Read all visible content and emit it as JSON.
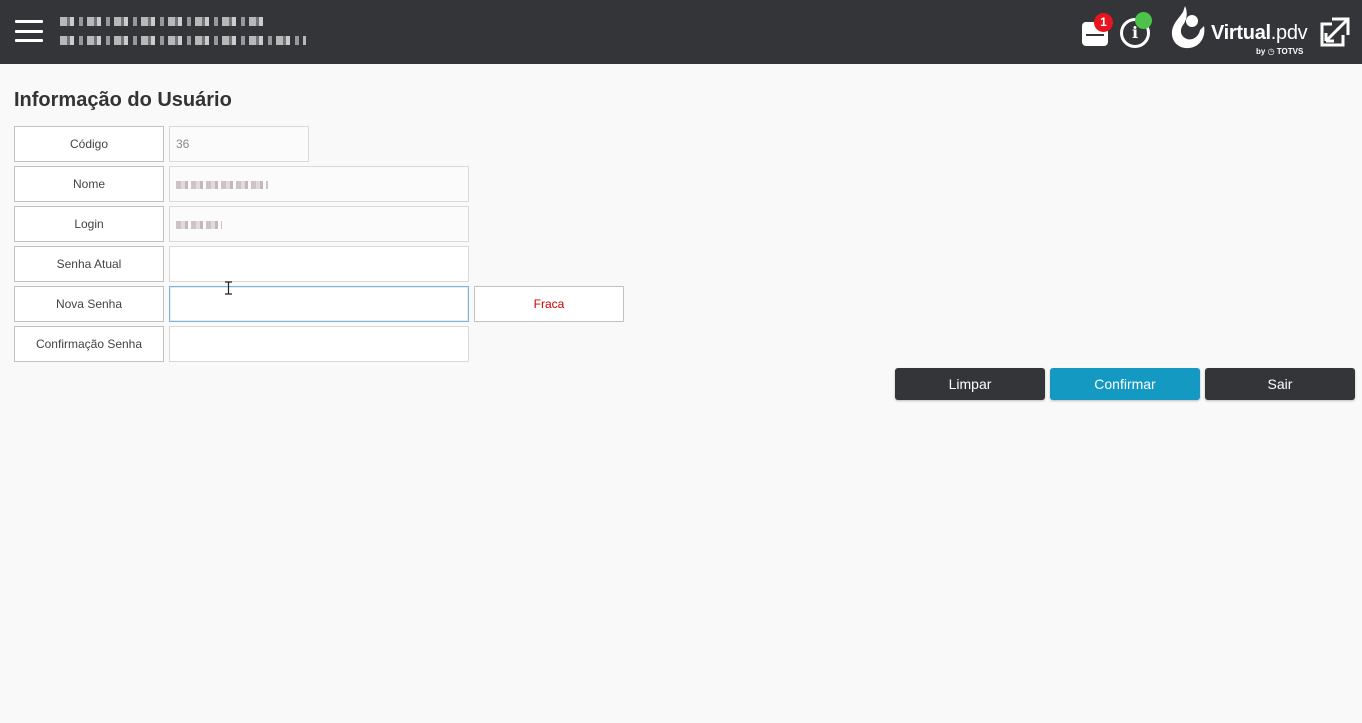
{
  "header": {
    "menu_icon": "hamburger-menu-icon",
    "notifications": {
      "icon": "receipt-icon",
      "badge_count": "1",
      "badge_color": "#e8141f"
    },
    "info": {
      "icon": "info-icon",
      "status_color": "#4cc24a"
    },
    "brand": {
      "name_bold": "Virtual",
      "name_light": ".pdv",
      "by": "by",
      "by_company": "TOTVS"
    },
    "popout_icon": "external-window-icon",
    "background_color": "#343538"
  },
  "form": {
    "title": "Informação do Usuário",
    "fields": {
      "codigo": {
        "label": "Código",
        "value": "36"
      },
      "nome": {
        "label": "Nome"
      },
      "login": {
        "label": "Login"
      },
      "senha_atual": {
        "label": "Senha Atual",
        "value": ""
      },
      "nova_senha": {
        "label": "Nova Senha",
        "value": "",
        "strength": "Fraca",
        "strength_color": "#cc0000"
      },
      "confirmacao": {
        "label": "Confirmação Senha",
        "value": ""
      }
    }
  },
  "actions": {
    "limpar": "Limpar",
    "confirmar": "Confirmar",
    "sair": "Sair",
    "primary_color": "#1399c2",
    "dark_color": "#343538"
  }
}
